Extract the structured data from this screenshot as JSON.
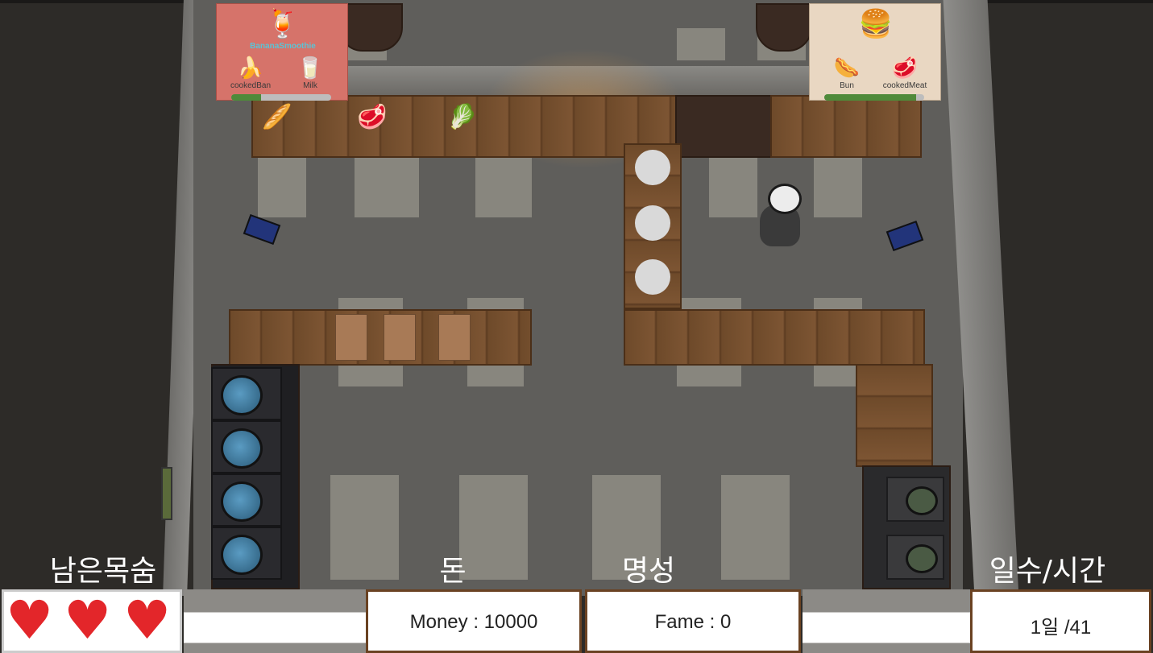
{
  "orders": [
    {
      "dish": "BananaSmoothie",
      "dish_icon": "🍹",
      "ingredients": [
        {
          "icon": "🍌",
          "label": "cookedBan"
        },
        {
          "icon": "🥛",
          "label": "Milk"
        }
      ],
      "progress": 0.3
    },
    {
      "dish": "",
      "dish_icon": "🍔",
      "ingredients": [
        {
          "icon": "🌭",
          "label": "Bun"
        },
        {
          "icon": "🥩",
          "label": "cookedMeat"
        }
      ],
      "progress": 0.92
    }
  ],
  "counter_items": [
    {
      "icon": "🥖",
      "name": "bread"
    },
    {
      "icon": "🥩",
      "name": "meat"
    },
    {
      "icon": "🥬",
      "name": "lettuce"
    }
  ],
  "hud": {
    "lives_label": "남은목숨",
    "money_label": "돈",
    "fame_label": "명성",
    "day_time_label": "일수/시간",
    "money_text": "Money : 10000",
    "fame_text": "Fame : 0",
    "day_time_text": "1일 /41",
    "lives": 3
  },
  "colors": {
    "heart": "#e3262a",
    "progress": "#4f8a3a",
    "hud_border": "#6a4222"
  }
}
